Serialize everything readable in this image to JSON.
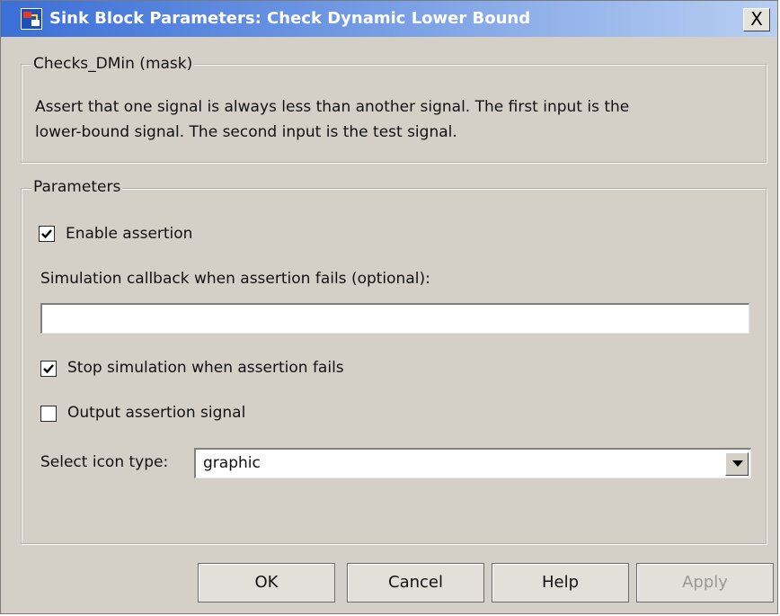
{
  "window": {
    "title": "Sink Block Parameters: Check Dynamic Lower Bound",
    "close_label": "X"
  },
  "mask_group": {
    "legend": "Checks_DMin (mask)",
    "description_line1": "Assert that one signal is always less than another signal.  The first input is the",
    "description_line2": "lower-bound signal.  The second input is the test signal."
  },
  "parameters": {
    "legend": "Parameters",
    "enable_assertion": {
      "label": "Enable assertion",
      "checked": true
    },
    "callback_label": "Simulation callback when assertion fails (optional):",
    "callback_value": "",
    "stop_simulation": {
      "label": "Stop simulation when assertion fails",
      "checked": true
    },
    "output_signal": {
      "label": "Output assertion signal",
      "checked": false
    },
    "icon_type_label": "Select icon type:",
    "icon_type_value": "graphic"
  },
  "buttons": {
    "ok": "OK",
    "cancel": "Cancel",
    "help": "Help",
    "apply": "Apply"
  },
  "icons": [
    "simulink-block-icon",
    "close-icon",
    "checkmark-icon",
    "dropdown-arrow-icon"
  ]
}
